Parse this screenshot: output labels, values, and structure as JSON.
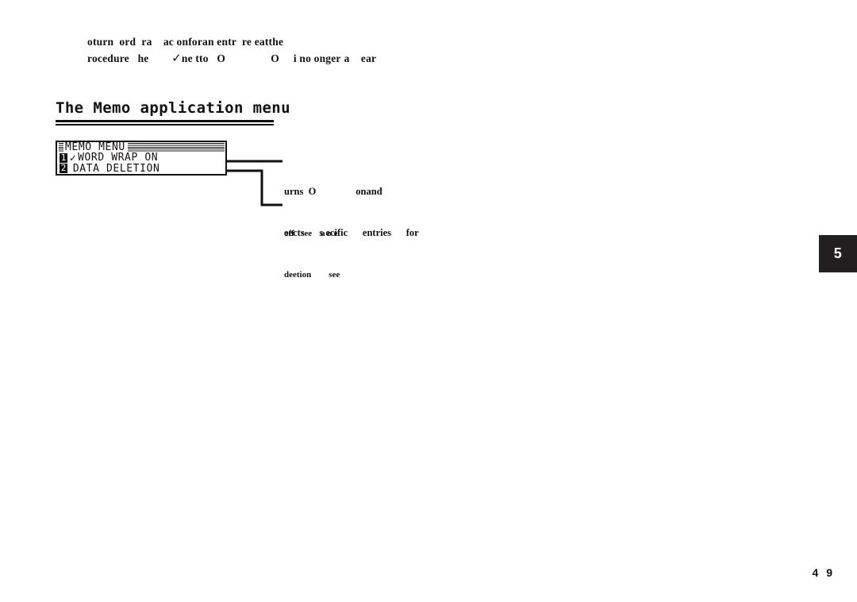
{
  "page": {
    "folio": "4 9",
    "chapter_tab": "5"
  },
  "intro": {
    "line1": "oturn  ord  ra    ac onforan entr  re eatthe",
    "line2_a": "rocedure   he        ",
    "line2_check": "✓",
    "line2_b": "ne tto   O                O     i no onger",
    "line3": "a    ear"
  },
  "heading": {
    "title": "The Memo application menu"
  },
  "lcd": {
    "title": "MEMO MENU",
    "items": [
      {
        "number": "1",
        "check": "✓",
        "label": "WORD WRAP ON"
      },
      {
        "number": "2",
        "check": " ",
        "label": "DATA DELETION"
      }
    ]
  },
  "callouts": [
    {
      "line1": "urns  O                onand",
      "line2": "off   see    a o e"
    },
    {
      "line1": "eects      s ecific      entries      for",
      "line2": "deetion        see"
    }
  ],
  "colors": {
    "ink": "#14100f",
    "tab_background": "#231f20",
    "tab_text": "#ffffff",
    "page_background": "#ffffff"
  }
}
